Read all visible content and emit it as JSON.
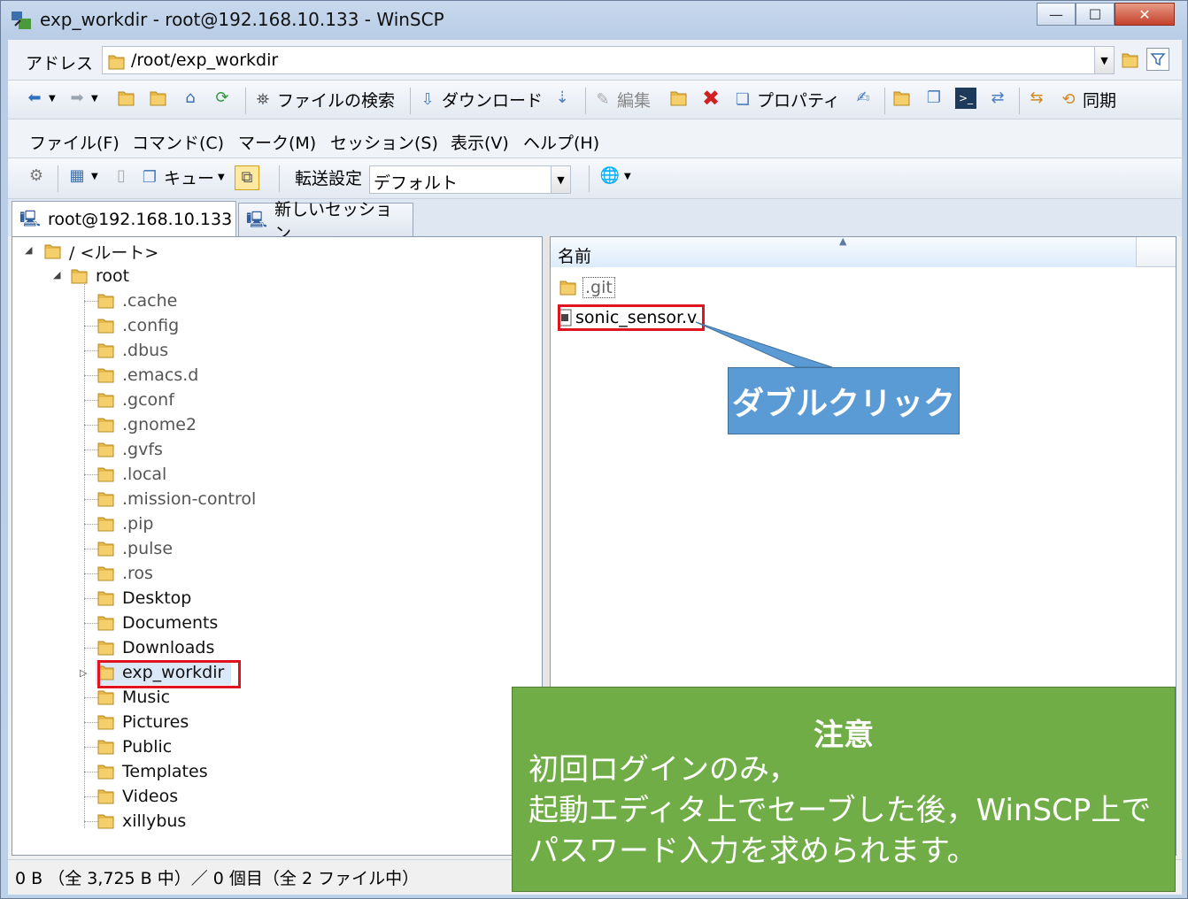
{
  "window": {
    "title": "exp_workdir - root@192.168.10.133 - WinSCP",
    "minimize": "—",
    "maximize": "☐",
    "close": "✕"
  },
  "address": {
    "label": "アドレス",
    "path": "/root/exp_workdir"
  },
  "toolbar": {
    "find_label": "ファイルの検索",
    "download_label": "ダウンロード",
    "edit_label": "編集",
    "properties_label": "プロパティ",
    "sync_label": "同期"
  },
  "menu": {
    "items": [
      "ファイル(F)",
      "コマンド(C)",
      "マーク(M)",
      "セッション(S)",
      "表示(V)",
      "ヘルプ(H)"
    ]
  },
  "toolbar2": {
    "queue_label": "キュー",
    "transfer_label": "転送設定",
    "transfer_value": "デフォルト"
  },
  "tabs": [
    {
      "label": "root@192.168.10.133"
    },
    {
      "label": "新しいセッション"
    }
  ],
  "tree": {
    "root_label": "/ <ルート>",
    "home_label": "root",
    "items": [
      ".cache",
      ".config",
      ".dbus",
      ".emacs.d",
      ".gconf",
      ".gnome2",
      ".gvfs",
      ".local",
      ".mission-control",
      ".pip",
      ".pulse",
      ".ros",
      "Desktop",
      "Documents",
      "Downloads",
      "exp_workdir",
      "Music",
      "Pictures",
      "Public",
      "Templates",
      "Videos",
      "xillybus"
    ]
  },
  "files": {
    "column_name": "名前",
    "items": [
      ".git",
      "sonic_sensor.v"
    ]
  },
  "status": {
    "text": "0 B （全 3,725 B 中）／ 0 個目（全 2 ファイル中）"
  },
  "callout": {
    "text": "ダブルクリック"
  },
  "note": {
    "title": "注意",
    "lines": [
      "初回ログインのみ，",
      "起動エディタ上でセーブした後，WinSCP上で",
      "パスワード入力を求められます。"
    ]
  },
  "colors": {
    "callout_bg": "#5b9bd5",
    "note_bg": "#70ad47",
    "highlight": "#e0141e"
  }
}
